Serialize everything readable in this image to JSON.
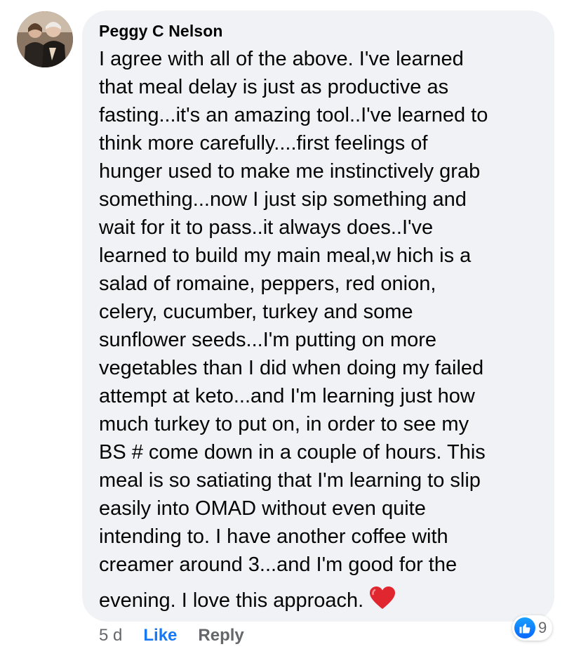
{
  "comment": {
    "author": "Peggy C Nelson",
    "lines": [
      "I agree with all of the above.  I've learned",
      "that meal delay is just as productive as",
      "fasting...it's an amazing tool..I've learned to",
      "think more carefully....first feelings of",
      "hunger used to make me instinctively grab",
      "something...now I just sip something and",
      "wait for it to pass..it always does..I've",
      "learned to build my main meal,w hich is a",
      "salad of romaine, peppers, red onion,",
      "celery, cucumber, turkey and some",
      "sunflower seeds...I'm putting on more",
      "vegetables than I did when doing my failed",
      "attempt at keto...and I'm learning just how",
      "much turkey to put on, in order to see my",
      "BS # come down in a couple of hours. This",
      "meal is so satiating that I'm learning to slip",
      "easily into OMAD without even quite",
      "intending to.  I have another coffee with",
      "creamer around 3...and I'm good for the",
      "evening.  I love this approach."
    ],
    "emoji": "heart-emoji",
    "age": "5 d",
    "like_label": "Like",
    "reply_label": "Reply",
    "reaction_icon": "like-icon",
    "reaction_count": "9"
  },
  "colors": {
    "bubble": "#f0f2f5",
    "text": "#050505",
    "meta": "#65676b",
    "like_link": "#1877f2",
    "heart": "#e0262f"
  }
}
